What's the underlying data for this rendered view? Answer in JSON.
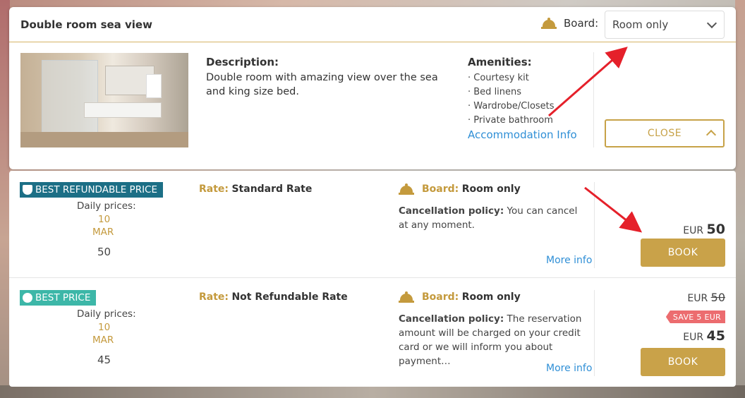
{
  "room": {
    "title": "Double room sea view",
    "board_label": "Board:",
    "board_selected": "Room only",
    "description_title": "Description:",
    "description_text": "Double room with amazing view over the sea and king size bed.",
    "amenities_title": "Amenities:",
    "amenities": [
      "· Courtesy kit",
      "· Bed linens",
      "· Wardrobe/Closets",
      "· Private bathroom"
    ],
    "accommodation_info": "Accommodation Info",
    "close_label": "CLOSE"
  },
  "rates": [
    {
      "badge": "BEST REFUNDABLE PRICE",
      "daily_prices_label": "Daily prices:",
      "day": "10",
      "month": "MAR",
      "daily_price": "50",
      "rate_prefix": "Rate:",
      "rate_name": "Standard Rate",
      "board_prefix": "Board:",
      "board_value": "Room only",
      "cancel_prefix": "Cancellation policy:",
      "cancel_text": "You can cancel at any moment.",
      "more_info": "More info",
      "currency": "EUR",
      "price": "50",
      "book_label": "BOOK"
    },
    {
      "badge": "BEST PRICE",
      "daily_prices_label": "Daily prices:",
      "day": "10",
      "month": "MAR",
      "daily_price": "45",
      "rate_prefix": "Rate:",
      "rate_name": "Not Refundable Rate",
      "board_prefix": "Board:",
      "board_value": "Room only",
      "cancel_prefix": "Cancellation policy:",
      "cancel_text": "The reservation amount will be charged on your credit card or we will inform you about payment…",
      "more_info": "More info",
      "currency": "EUR",
      "old_price": "50",
      "save_tag": "SAVE 5 EUR",
      "price": "45",
      "book_label": "BOOK"
    }
  ],
  "colors": {
    "gold": "#c49a3d",
    "link": "#2f8fd6",
    "badge_refundable": "#1c6f86",
    "badge_best": "#3db7a8",
    "save_tag": "#ec6c6f",
    "arrow": "#e5202a"
  }
}
